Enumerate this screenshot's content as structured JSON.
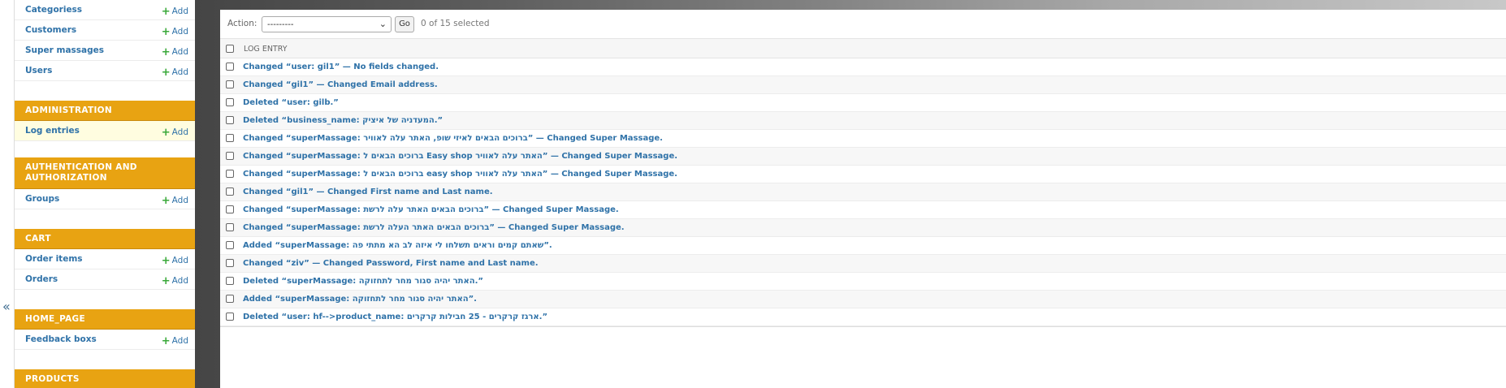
{
  "sidebar": {
    "top_rows": [
      {
        "label": "Categoriess",
        "add": "Add"
      },
      {
        "label": "Customers",
        "add": "Add"
      },
      {
        "label": "Super massages",
        "add": "Add"
      },
      {
        "label": "Users",
        "add": "Add"
      }
    ],
    "administration": {
      "title": "ADMINISTRATION",
      "row": {
        "label": "Log entries",
        "add": "Add"
      }
    },
    "auth": {
      "title": "AUTHENTICATION AND AUTHORIZATION",
      "row": {
        "label": "Groups",
        "add": "Add"
      }
    },
    "cart": {
      "title": "CART",
      "rows": [
        {
          "label": "Order items",
          "add": "Add"
        },
        {
          "label": "Orders",
          "add": "Add"
        }
      ]
    },
    "home": {
      "title": "HOME_PAGE",
      "row": {
        "label": "Feedback boxs",
        "add": "Add"
      }
    },
    "products": {
      "title": "PRODUCTS"
    },
    "collapse_glyph": "«",
    "plus_glyph": "+"
  },
  "actions": {
    "label": "Action:",
    "selected_option": "---------",
    "go_label": "Go",
    "count": "0 of 15 selected"
  },
  "table": {
    "header": "LOG ENTRY",
    "rows": [
      "Changed “user: gil1” — No fields changed.",
      "Changed “gil1” — Changed Email address.",
      "Deleted “user: gilb.”",
      "Deleted “business_name: המעדניה של איציק.”",
      "Changed “superMassage: ברוכים הבאים לאיזי שופ, האתר עלה לאוויר” — Changed Super Massage.",
      "Changed “superMassage: ברוכים הבאים ל Easy shop האתר עלה לאוויר” — Changed Super Massage.",
      "Changed “superMassage: ברוכים הבאים ל easy shop האתר עלה לאוויר” — Changed Super Massage.",
      "Changed “gil1” — Changed First name and Last name.",
      "Changed “superMassage: ברוכים הבאים האתר עלה לרשת” — Changed Super Massage.",
      "Changed “superMassage: ברוכים הבאים האתר העלה לרשת” — Changed Super Massage.",
      "Added “superMassage: שאתם קמים וראים תשלחו לי איזה לב הא מתתי פה”.",
      "Changed “ziv” — Changed Password, First name and Last name.",
      "Deleted “superMassage: האתר יהיה סגור מחר לתחזוקה.”",
      "Added “superMassage: האתר יהיה סגור מחר לתחזוקה”.",
      "Deleted “user: hf-->product_name: ארגז קרקרים - 25 חבילות קרקרים.”"
    ]
  },
  "colors": {
    "section_header": "#e8a312",
    "link": "#2f72a8",
    "add_plus": "#39a839",
    "active_row": "#fffde0"
  }
}
